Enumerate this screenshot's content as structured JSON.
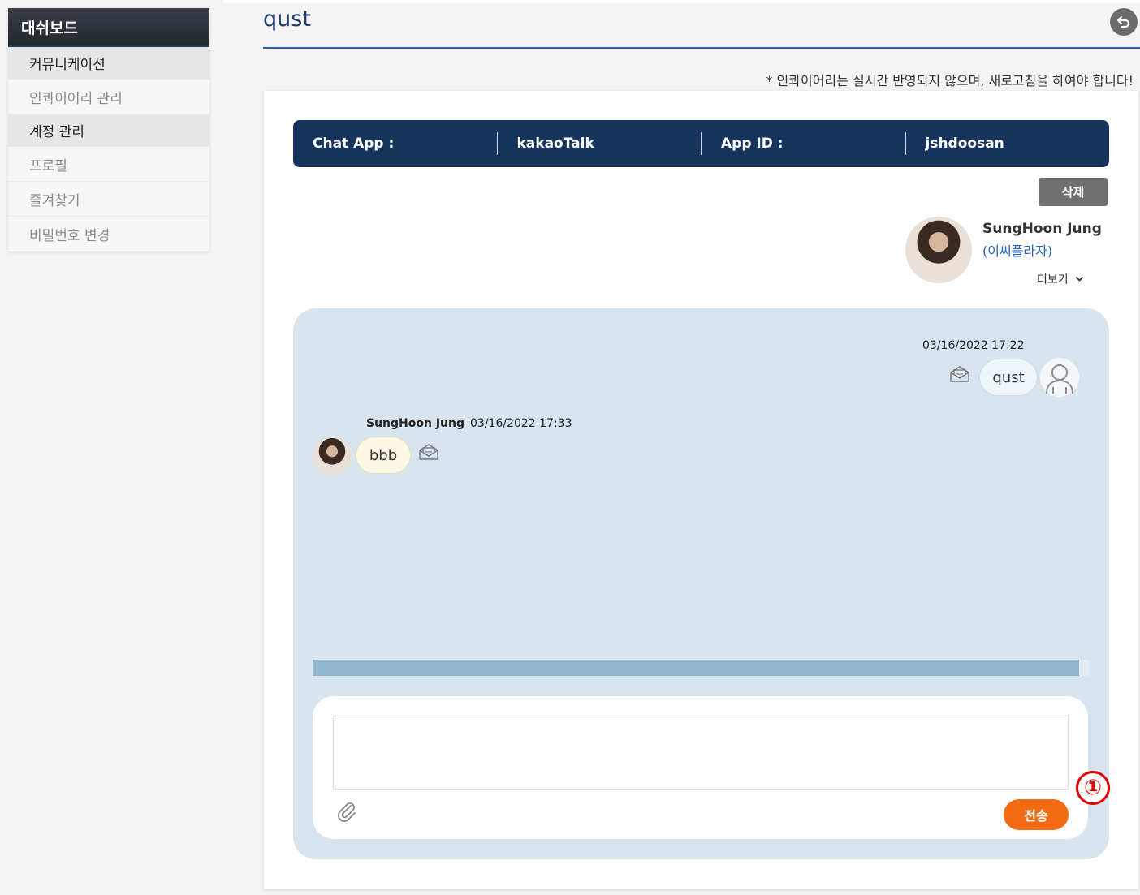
{
  "sidebar": {
    "title": "대쉬보드",
    "sections": [
      {
        "label": "커뮤니케이션",
        "items": [
          "인콰이어리 관리"
        ]
      },
      {
        "label": "계정 관리",
        "items": [
          "프로필",
          "즐겨찾기",
          "비밀번호 변경"
        ]
      }
    ]
  },
  "header": {
    "title": "qust",
    "notice": "* 인콰이어리는 실시간 반영되지 않으며, 새로고침을 하여야 합니다!"
  },
  "info_bar": {
    "chat_app_label": "Chat App :",
    "chat_app_value": "kakaoTalk",
    "app_id_label": "App ID :",
    "app_id_value": "jshdoosan"
  },
  "actions": {
    "delete_label": "삭제"
  },
  "profile": {
    "name": "SungHoon Jung",
    "org": "(이씨플라자)",
    "more_label": "더보기"
  },
  "messages": [
    {
      "side": "right",
      "time": "03/16/2022 17:22",
      "text": "qust"
    },
    {
      "side": "left",
      "sender": "SungHoon Jung",
      "time": "03/16/2022 17:33",
      "text": "bbb"
    }
  ],
  "composer": {
    "value": "",
    "send_label": "전송"
  },
  "annotation": {
    "marker": "①"
  },
  "colors": {
    "primary": "#17345c",
    "accent": "#f26b12",
    "chat_bg": "#d8e4ee",
    "link": "#1f63c4"
  }
}
